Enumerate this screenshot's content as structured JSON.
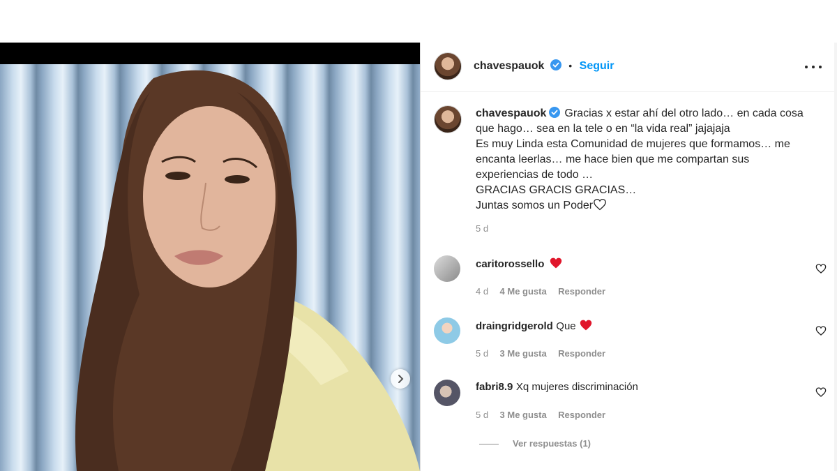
{
  "post": {
    "author": "chavespauok",
    "follow_label": "Seguir",
    "dot": "•",
    "caption_lines": [
      "Gracias x estar ahí del otro lado… en cada cosa",
      "que hago… sea en la tele o en “la vida real” jajajaja",
      "Es muy Linda esta Comunidad de mujeres que formamos… me",
      "encanta leerlas… me hace bien que me compartan sus",
      "experiencias de todo …",
      "GRACIAS GRACIS GRACIAS…",
      "Juntas somos un Poder"
    ],
    "caption_age": "5 d",
    "photo_next_icon": "chevron-right-icon"
  },
  "comments": [
    {
      "user": "caritorossello",
      "text": "",
      "emoji": "red-heart",
      "age": "4 d",
      "likes": "4 Me gusta",
      "reply": "Responder"
    },
    {
      "user": "draingridgerold",
      "text": "Que",
      "emoji": "red-heart",
      "age": "5 d",
      "likes": "3 Me gusta",
      "reply": "Responder"
    },
    {
      "user": "fabri8.9",
      "text": "Xq mujeres discriminación",
      "emoji": "",
      "age": "5 d",
      "likes": "3 Me gusta",
      "reply": "Responder"
    }
  ],
  "view_replies": "Ver respuestas (1)",
  "colors": {
    "accent": "#0095f6",
    "heart": "#ed4956",
    "muted": "#8e8e8e",
    "text": "#262626"
  }
}
